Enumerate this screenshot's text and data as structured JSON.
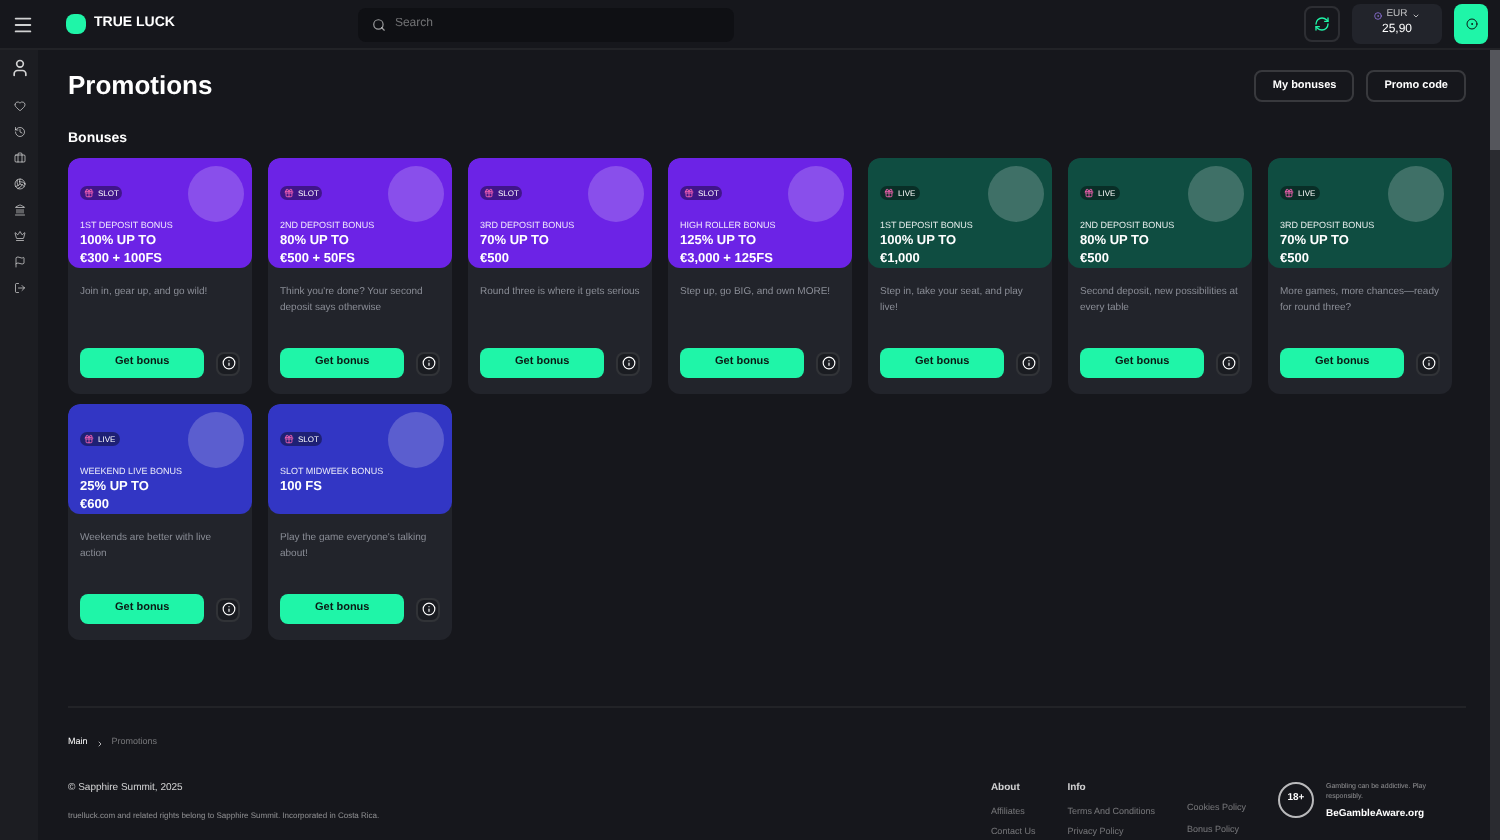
{
  "header": {
    "logo": "TRUE LUCK",
    "search": {
      "placeholder": "Search"
    },
    "balance": {
      "currency": "EUR",
      "amount": "25,90"
    }
  },
  "page": {
    "title": "Promotions",
    "buttons": [
      "My bonuses",
      "Promo code"
    ]
  },
  "section": "Bonuses",
  "bonuses": [
    {
      "badge": "SLOT",
      "color": "#6c23e6",
      "category": "1ST DEPOSIT BONUS",
      "offer": [
        "100% UP TO",
        "€300 + 100FS"
      ],
      "description": "Join in, gear up, and go wild!",
      "button": "Get bonus"
    },
    {
      "badge": "SLOT",
      "color": "#6c23e6",
      "category": "2ND DEPOSIT BONUS",
      "offer": [
        "80% UP TO",
        "€500 + 50FS"
      ],
      "description": "Think you're done? Your second deposit says otherwise",
      "button": "Get bonus"
    },
    {
      "badge": "SLOT",
      "color": "#6c23e6",
      "category": "3RD DEPOSIT BONUS",
      "offer": [
        "70% UP TO",
        "€500"
      ],
      "description": "Round three is where it gets serious",
      "button": "Get bonus"
    },
    {
      "badge": "SLOT",
      "color": "#6c23e6",
      "category": "HIGH ROLLER BONUS",
      "offer": [
        "125% UP TO",
        "€3,000 + 125FS"
      ],
      "description": "Step up, go BIG, and own MORE!",
      "button": "Get bonus"
    },
    {
      "badge": "LIVE",
      "color": "#0f4d41",
      "category": "1ST DEPOSIT BONUS",
      "offer": [
        "100% UP TO",
        "€1,000"
      ],
      "description": "Step in, take your seat, and play live!",
      "button": "Get bonus"
    },
    {
      "badge": "LIVE",
      "color": "#0f4d41",
      "category": "2ND DEPOSIT BONUS",
      "offer": [
        "80% UP TO",
        "€500"
      ],
      "description": "Second deposit, new possibilities at every table",
      "button": "Get bonus"
    },
    {
      "badge": "LIVE",
      "color": "#0f4d41",
      "category": "3RD DEPOSIT BONUS",
      "offer": [
        "70% UP TO",
        "€500"
      ],
      "description": "More games, more chances—ready for round three?",
      "button": "Get bonus"
    },
    {
      "badge": "LIVE",
      "color": "#3236c4",
      "category": "WEEKEND LIVE BONUS",
      "offer": [
        "25% UP TO",
        "€600"
      ],
      "description": "Weekends are better with live action",
      "button": "Get bonus"
    },
    {
      "badge": "SLOT",
      "color": "#3236c4",
      "category": "SLOT MIDWEEK BONUS",
      "offer": [
        "100 FS"
      ],
      "description": "Play the game everyone's talking about!",
      "button": "Get bonus"
    }
  ],
  "breadcrumb": [
    "Main",
    "Promotions"
  ],
  "footer": {
    "copyright": "© Sapphire Summit, 2025",
    "legal": "truelluck.com and related rights belong to Sapphire Summit. Incorporated in Costa Rica.",
    "columns": [
      {
        "title": "About",
        "links": [
          "Affiliates",
          "Contact Us"
        ]
      },
      {
        "title": "Info",
        "links": [
          "Terms And Conditions",
          "Privacy Policy"
        ]
      },
      {
        "links": [
          "Cookies Policy",
          "Bonus Policy"
        ]
      }
    ],
    "age": "18+",
    "notice": "Gambling can be addictive. Play responsibly.",
    "aware": "BeGambleAware.org"
  }
}
